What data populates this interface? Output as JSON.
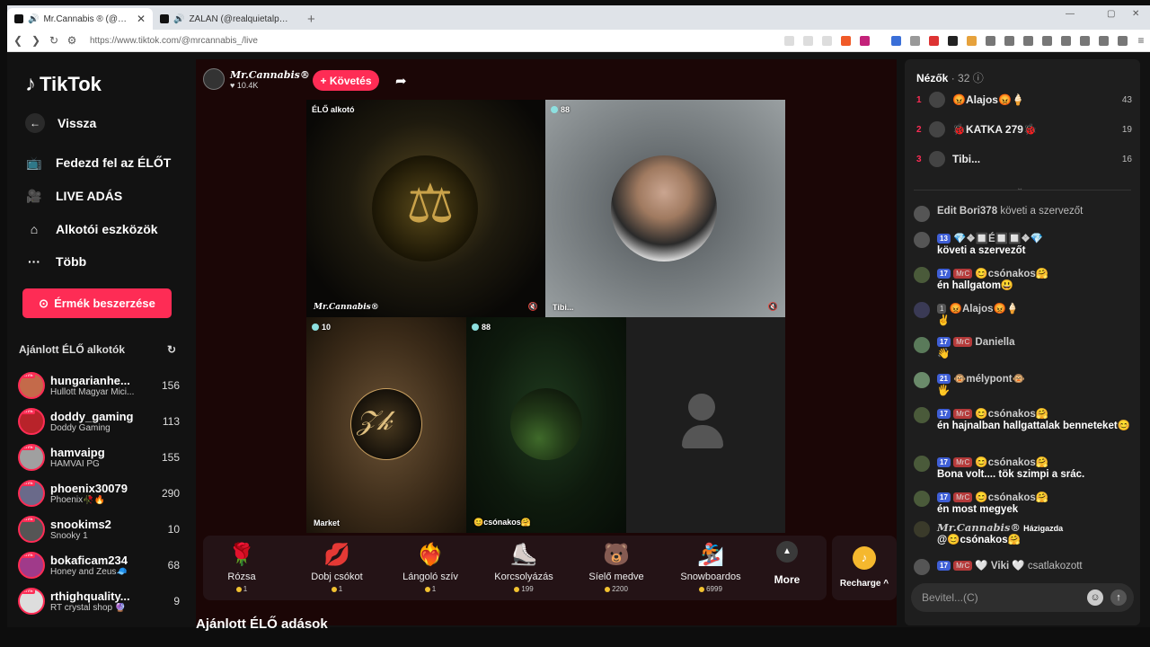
{
  "browser": {
    "tabs": [
      {
        "title": "Mr.Cannabis ® (@mrcannabis",
        "active": true
      },
      {
        "title": "ZALÁN (@realquietalpha)",
        "active": false
      }
    ],
    "url": "https://www.tiktok.com/@mrcannabis_/live"
  },
  "sidebar": {
    "logo": "TikTok",
    "back": "Vissza",
    "items": [
      "Fedezd fel az ÉLŐT",
      "LIVE ADÁS",
      "Alkotói eszközök",
      "Több"
    ],
    "coins_button": "Érmék beszerzése",
    "suggested_title": "Ajánlott ÉLŐ alkotók",
    "suggested": [
      {
        "name": "hungarianhe...",
        "desc": "Hullott Magyar Mici...",
        "count": "156"
      },
      {
        "name": "doddy_gaming",
        "desc": "Doddy Gaming",
        "count": "113"
      },
      {
        "name": "hamvaipg",
        "desc": "HAMVAI PG",
        "count": "155"
      },
      {
        "name": "phoenix30079",
        "desc": "Phoenix🥀🔥",
        "count": "290"
      },
      {
        "name": "snookims2",
        "desc": "Snooky 1",
        "count": "10"
      },
      {
        "name": "bokaficam234",
        "desc": "Honey and Zeus🧢",
        "count": "68"
      },
      {
        "name": "rthighquality...",
        "desc": "RT crystal shop 🔮",
        "count": "9"
      }
    ],
    "live_tag": "LIVE"
  },
  "stream": {
    "host_name": "Mr.Cannabis®",
    "host_likes": "10.4K",
    "follow": "+ Követés",
    "cells": [
      {
        "badge": "ÉLŐ alkotó",
        "name": "Mr.Cannabis®"
      },
      {
        "badge": "88",
        "name": "Tibi..."
      },
      {
        "badge": "10",
        "name": "Market"
      },
      {
        "badge": "88",
        "name": "😊csónakos🤗"
      },
      {
        "badge": "",
        "name": ""
      }
    ],
    "gifts": [
      {
        "name": "Rózsa",
        "price": "1",
        "icon": "🌹"
      },
      {
        "name": "Dobj csókot",
        "price": "1",
        "icon": "💋"
      },
      {
        "name": "Lángoló szív",
        "price": "1",
        "icon": "❤️‍🔥"
      },
      {
        "name": "Korcsolyázás",
        "price": "199",
        "icon": "⛸️"
      },
      {
        "name": "Síelő medve",
        "price": "2200",
        "icon": "🐻"
      },
      {
        "name": "Snowboardos",
        "price": "6999",
        "icon": "🏂"
      }
    ],
    "more": "More",
    "recharge": "Recharge",
    "below_title": "Ajánlott ÉLŐ adások"
  },
  "panel": {
    "viewers_label": "Nézők",
    "viewers_count": "· 32",
    "top": [
      {
        "rank": "1",
        "name": "😡Alajos😡🍦",
        "score": "43"
      },
      {
        "rank": "2",
        "name": "🐞KATKA 279🐞",
        "score": "19"
      },
      {
        "rank": "3",
        "name": "Tibi...",
        "score": "16"
      }
    ],
    "messages": [
      {
        "user": "Edit Bori378",
        "text": "követi a szervezőt"
      },
      {
        "level": "13",
        "user": "💎❖🔲É🔲🔲❖💎",
        "text": "követi a szervezőt"
      },
      {
        "level": "17",
        "fan": "MrC",
        "user": "😊csónakos🤗",
        "text": "én hallgatom😃"
      },
      {
        "user": "😡Alajos😡🍦",
        "fan": "1",
        "text": "✌️"
      },
      {
        "level": "17",
        "fan": "MrC",
        "user": "Daniella",
        "text": "👋"
      },
      {
        "level": "21",
        "user": "🐵mélypont🐵",
        "text": "🖐️"
      },
      {
        "level": "17",
        "fan": "MrC",
        "user": "😊csónakos🤗",
        "text": "én hajnalban hallgattalak benneteket😊"
      },
      {
        "level": "17",
        "fan": "MrC",
        "user": "😊csónakos🤗",
        "text": "Bona volt.... tök szimpi a srác."
      },
      {
        "level": "17",
        "fan": "MrC",
        "user": "😊csónakos🤗",
        "text": "én most megyek"
      },
      {
        "user": "Mr.Cannabis®",
        "role": "Házigazda",
        "text": "@😊csónakos🤗"
      },
      {
        "level": "17",
        "fan": "MrC",
        "user": "🤍 Viki 🤍",
        "text": "csatlakozott"
      }
    ],
    "input_placeholder": "Bevitel...(C)"
  }
}
